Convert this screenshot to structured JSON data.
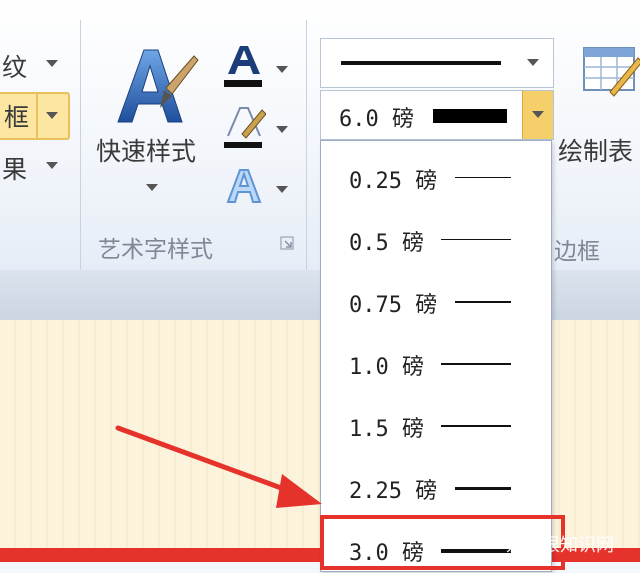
{
  "ribbon": {
    "left_group": {
      "texture_label": "纹",
      "border_label": "框",
      "effect_label": "果"
    },
    "wordart": {
      "quick_styles_label": "快速样式",
      "group_label": "艺术字样式",
      "text_fill_icon": "text-fill-A-icon",
      "text_outline_icon": "text-outline-pen-icon",
      "text_effects_icon": "text-effects-A-icon",
      "dialog_launcher_icon": "dialog-launcher-icon"
    },
    "borders": {
      "weight_selected": "6.0 磅",
      "group_label": "边框",
      "draw_table_label": "绘制表"
    }
  },
  "weight_menu": {
    "items": [
      {
        "label": "0.25 磅"
      },
      {
        "label": "0.5 磅"
      },
      {
        "label": "0.75 磅"
      },
      {
        "label": "1.0 磅"
      },
      {
        "label": "1.5 磅"
      },
      {
        "label": "2.25 磅"
      },
      {
        "label": "3.0 磅"
      }
    ],
    "highlighted_item": "3.0 磅"
  },
  "watermark": "爱创根知识网",
  "colors": {
    "accent_red": "#e5322a",
    "dropdown_highlight": "#f4cf6a",
    "ribbon_bg": "#f3f6fb"
  }
}
